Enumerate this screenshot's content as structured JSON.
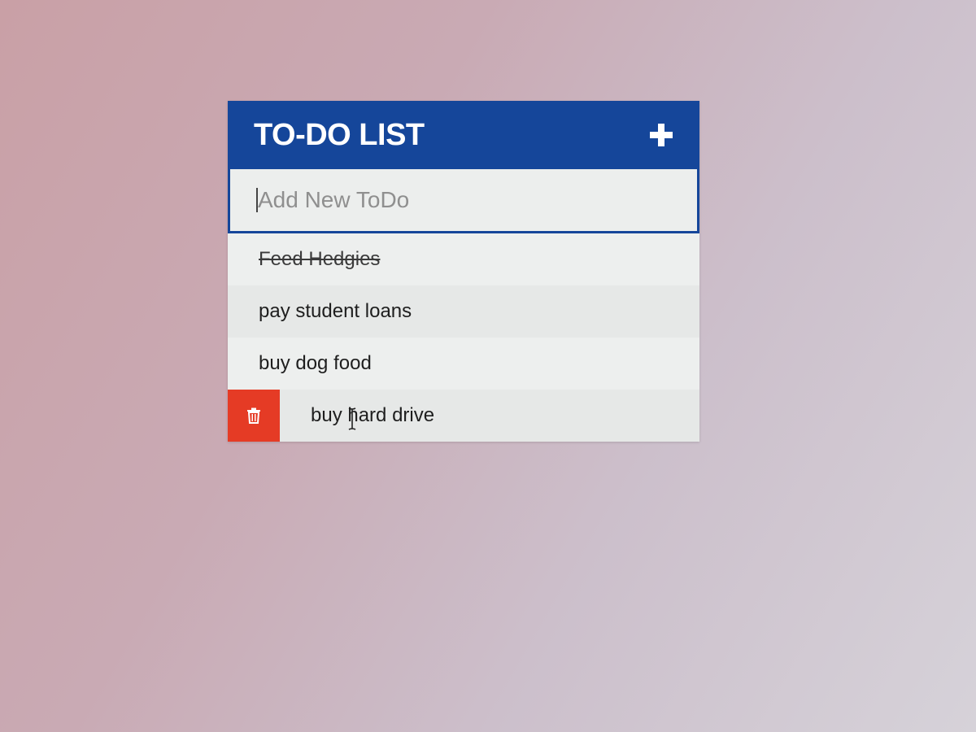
{
  "app": {
    "title": "TO-DO LIST",
    "add_toggle_icon": "plus-icon"
  },
  "input": {
    "placeholder": "Add New ToDo",
    "value": ""
  },
  "todos": [
    {
      "text": "Feed Hedgies",
      "completed": true
    },
    {
      "text": "pay student loans",
      "completed": false
    },
    {
      "text": "buy dog food",
      "completed": false
    },
    {
      "text": "buy hard drive",
      "completed": false,
      "hovered": true
    }
  ],
  "colors": {
    "header": "#15469a",
    "delete": "#e53b25",
    "list_background": "#e9ebea"
  },
  "icons": {
    "delete": "trash-icon"
  }
}
